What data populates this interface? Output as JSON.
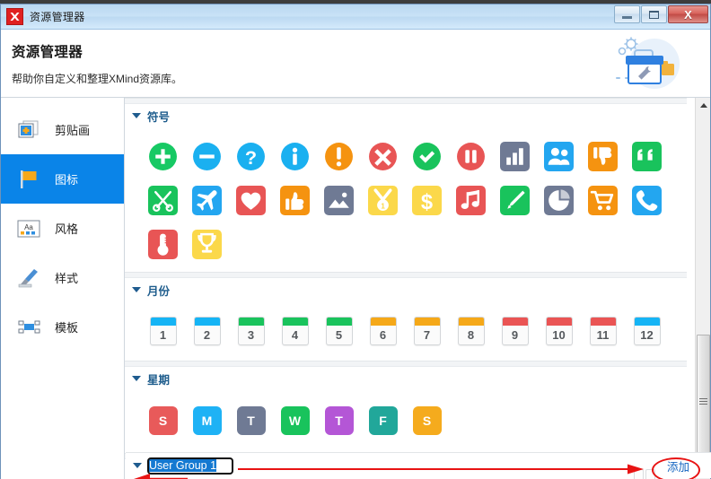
{
  "window": {
    "title": "资源管理器",
    "logo_icon": "xmind-logo-icon",
    "buttons": {
      "minimize": "minimize-button",
      "maximize": "maximize-button",
      "close_label": "X"
    }
  },
  "header": {
    "title": "资源管理器",
    "subtitle": "帮助你自定义和整理XMind资源库。",
    "illustration": "toolbox-gears-illustration"
  },
  "sidebar": {
    "items": [
      {
        "label": "剪贴画",
        "icon": "clipart-icon",
        "active": false
      },
      {
        "label": "图标",
        "icon": "flag-icon",
        "active": true
      },
      {
        "label": "风格",
        "icon": "font-style-icon",
        "active": false
      },
      {
        "label": "样式",
        "icon": "brush-icon",
        "active": false
      },
      {
        "label": "模板",
        "icon": "template-icon",
        "active": false
      }
    ],
    "active_color": "#0a84e8"
  },
  "sections": [
    {
      "id": "symbols",
      "title": "符号",
      "type": "icons",
      "icons": [
        {
          "name": "plus-circle-icon",
          "glyph": "plus",
          "shape": "circle",
          "color": "#17c964"
        },
        {
          "name": "minus-circle-icon",
          "glyph": "minus",
          "shape": "circle",
          "color": "#1ab0f0"
        },
        {
          "name": "question-circle-icon",
          "glyph": "question",
          "shape": "circle",
          "color": "#1ab0f0"
        },
        {
          "name": "info-circle-icon",
          "glyph": "info",
          "shape": "circle",
          "color": "#1ab0f0"
        },
        {
          "name": "exclamation-circle-icon",
          "glyph": "exclaim",
          "shape": "circle",
          "color": "#f59310"
        },
        {
          "name": "cross-circle-icon",
          "glyph": "cross",
          "shape": "circle",
          "color": "#e85555"
        },
        {
          "name": "check-circle-icon",
          "glyph": "check",
          "shape": "circle",
          "color": "#19c35c"
        },
        {
          "name": "pause-circle-icon",
          "glyph": "pause",
          "shape": "circle",
          "color": "#e85555"
        },
        {
          "name": "bar-chart-icon",
          "glyph": "barchart",
          "shape": "square",
          "color": "#6f7a94"
        },
        {
          "name": "people-icon",
          "glyph": "people",
          "shape": "square",
          "color": "#23a6f0"
        },
        {
          "name": "thumbs-down-icon",
          "glyph": "thumbdown",
          "shape": "square",
          "color": "#f59310"
        },
        {
          "name": "quote-icon",
          "glyph": "quote",
          "shape": "square",
          "color": "#19c35c"
        },
        {
          "name": "scissors-icon",
          "glyph": "scissors",
          "shape": "square",
          "color": "#19c35c"
        },
        {
          "name": "airplane-icon",
          "glyph": "plane",
          "shape": "square",
          "color": "#23a6f0"
        },
        {
          "name": "heart-icon",
          "glyph": "heart",
          "shape": "square",
          "color": "#e85555"
        },
        {
          "name": "thumbs-up-icon",
          "glyph": "thumbup",
          "shape": "square",
          "color": "#f59310"
        },
        {
          "name": "image-icon",
          "glyph": "image",
          "shape": "square",
          "color": "#6f7a94"
        },
        {
          "name": "medal-icon",
          "glyph": "medal",
          "shape": "square",
          "color": "#fbd84a"
        },
        {
          "name": "dollar-icon",
          "glyph": "dollar",
          "shape": "square",
          "color": "#fbd84a"
        },
        {
          "name": "music-icon",
          "glyph": "music",
          "shape": "square",
          "color": "#e85555"
        },
        {
          "name": "pencil-icon",
          "glyph": "pencil",
          "shape": "square",
          "color": "#19c35c"
        },
        {
          "name": "pie-chart-icon",
          "glyph": "pie",
          "shape": "square",
          "color": "#6f7a94"
        },
        {
          "name": "shopping-cart-icon",
          "glyph": "cart",
          "shape": "square",
          "color": "#f59310"
        },
        {
          "name": "phone-icon",
          "glyph": "phone",
          "shape": "square",
          "color": "#23a6f0"
        },
        {
          "name": "thermometer-icon",
          "glyph": "thermo",
          "shape": "square",
          "color": "#e85555"
        },
        {
          "name": "trophy-icon",
          "glyph": "trophy",
          "shape": "square",
          "color": "#fbd84a"
        }
      ]
    },
    {
      "id": "months",
      "title": "月份",
      "type": "months",
      "months": [
        {
          "label": "1",
          "color": "#15b4f5"
        },
        {
          "label": "2",
          "color": "#15b4f5"
        },
        {
          "label": "3",
          "color": "#19c35c"
        },
        {
          "label": "4",
          "color": "#19c35c"
        },
        {
          "label": "5",
          "color": "#19c35c"
        },
        {
          "label": "6",
          "color": "#f5a818"
        },
        {
          "label": "7",
          "color": "#f5a818"
        },
        {
          "label": "8",
          "color": "#f5a818"
        },
        {
          "label": "9",
          "color": "#ea5454"
        },
        {
          "label": "10",
          "color": "#ea5454"
        },
        {
          "label": "11",
          "color": "#ea5454"
        },
        {
          "label": "12",
          "color": "#15b4f5"
        }
      ]
    },
    {
      "id": "weekdays",
      "title": "星期",
      "type": "weekdays",
      "weekdays": [
        {
          "label": "S",
          "color": "#e85a5a"
        },
        {
          "label": "M",
          "color": "#1eb2f5"
        },
        {
          "label": "T",
          "color": "#6f7a94"
        },
        {
          "label": "W",
          "color": "#19c35c"
        },
        {
          "label": "T",
          "color": "#b456d6"
        },
        {
          "label": "F",
          "color": "#21a79a"
        },
        {
          "label": "S",
          "color": "#f5ab1d"
        }
      ]
    }
  ],
  "bottom": {
    "group_name_value": "User Group 1",
    "group_name_placeholder": "User Group 1",
    "add_label": "添加",
    "add_color": "#1565c0",
    "caret_icon": "caret-down-icon"
  },
  "annotations": {
    "highlight_color": "#e81313",
    "ellipse_target": "添加",
    "arrow_long": "arrow-pointing-to-add-button",
    "arrow_short": "arrow-pointing-to-group-name-input"
  },
  "scrollbar": {
    "up_arrow_icon": "scroll-up-arrow-icon",
    "thumb": "scroll-thumb"
  }
}
